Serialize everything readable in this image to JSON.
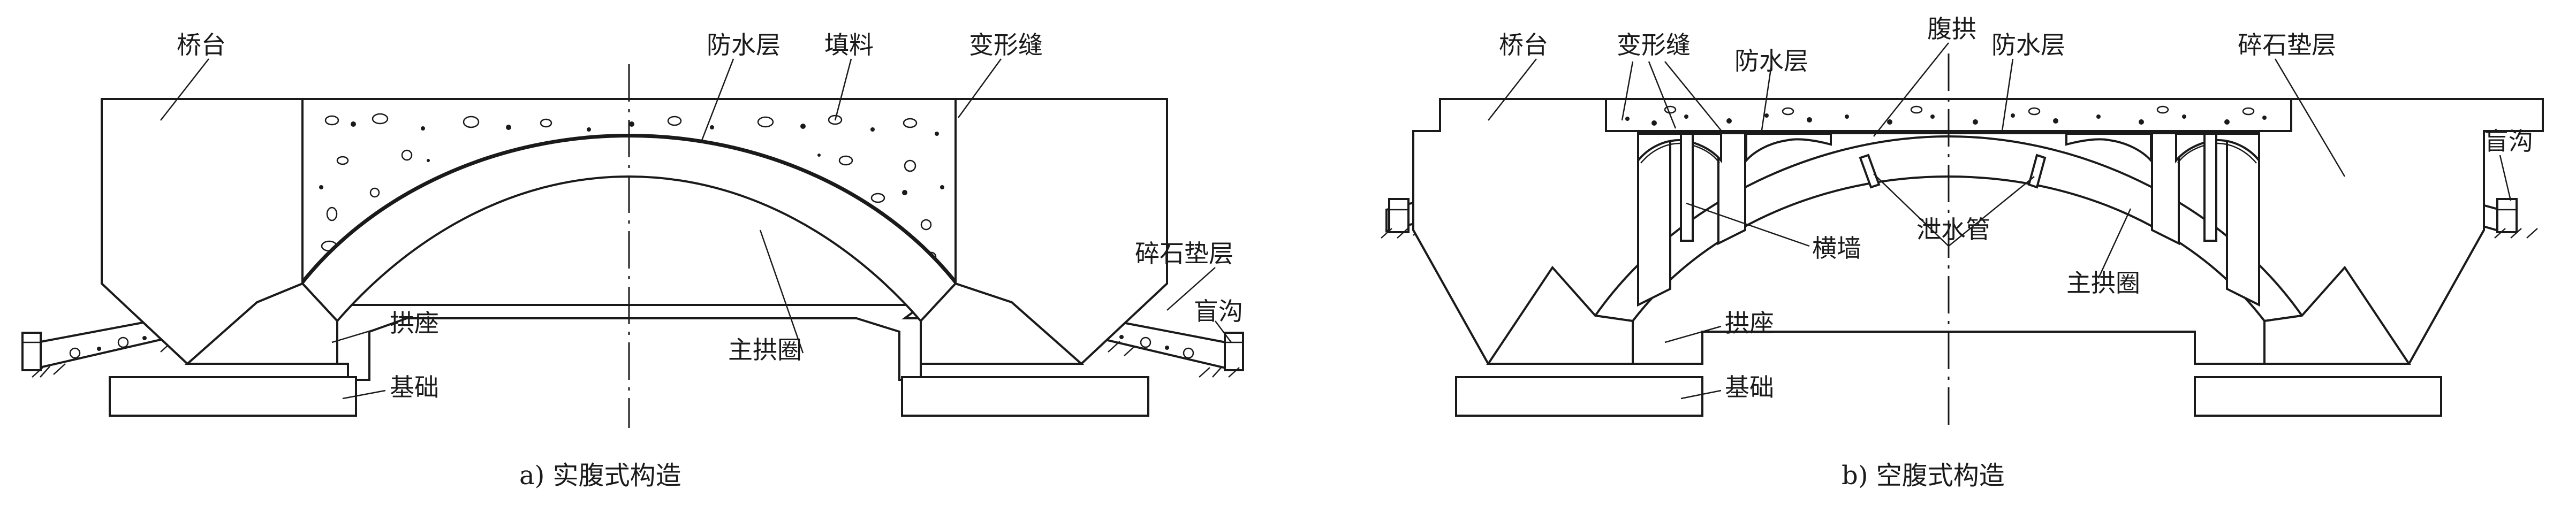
{
  "left": {
    "labels": {
      "abutment": "桥台",
      "waterproof": "防水层",
      "fill": "填料",
      "joint": "变形缝",
      "gravel": "碎石垫层",
      "drain": "盲沟",
      "skewback": "拱座",
      "foundation": "基础",
      "main_arch": "主拱圈"
    },
    "caption": "a) 实腹式构造"
  },
  "right": {
    "labels": {
      "abutment": "桥台",
      "joint": "变形缝",
      "waterproof_1": "防水层",
      "spandrel_arch": "腹拱",
      "waterproof_2": "防水层",
      "gravel": "碎石垫层",
      "drain": "盲沟",
      "cross_wall": "横墙",
      "drain_pipe": "泄水管",
      "main_arch": "主拱圈",
      "skewback": "拱座",
      "foundation": "基础"
    },
    "caption": "b) 空腹式构造"
  }
}
